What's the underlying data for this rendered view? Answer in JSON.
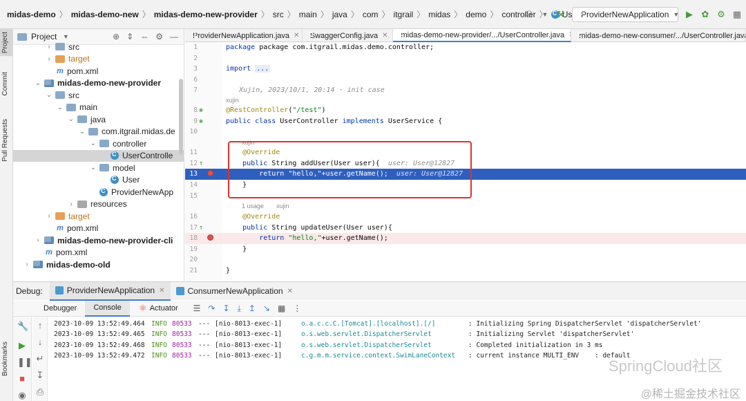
{
  "breadcrumb": {
    "items": [
      "midas-demo",
      "midas-demo-new",
      "midas-demo-new-provider",
      "src",
      "main",
      "java",
      "com",
      "itgrail",
      "midas",
      "demo",
      "controller",
      "UserController"
    ]
  },
  "toolbar": {
    "run_config": "ProviderNewApplication"
  },
  "left_stripe": {
    "project": "Project",
    "commit": "Commit",
    "pull_requests": "Pull Requests",
    "bookmarks": "Bookmarks"
  },
  "project_panel": {
    "title": "Project",
    "tree": [
      {
        "label": "src",
        "type": "folder"
      },
      {
        "label": "target",
        "type": "folder-excluded"
      },
      {
        "label": "pom.xml",
        "type": "maven"
      },
      {
        "label": "midas-demo-new-provider",
        "type": "module"
      },
      {
        "label": "src",
        "type": "folder"
      },
      {
        "label": "main",
        "type": "folder"
      },
      {
        "label": "java",
        "type": "folder"
      },
      {
        "label": "com.itgrail.midas.de",
        "type": "package"
      },
      {
        "label": "controller",
        "type": "package"
      },
      {
        "label": "UserControlle",
        "type": "class"
      },
      {
        "label": "model",
        "type": "package"
      },
      {
        "label": "User",
        "type": "class"
      },
      {
        "label": "ProviderNewApp",
        "type": "class"
      },
      {
        "label": "resources",
        "type": "folder"
      },
      {
        "label": "target",
        "type": "folder-excluded"
      },
      {
        "label": "pom.xml",
        "type": "maven"
      },
      {
        "label": "midas-demo-new-provider-cli",
        "type": "module"
      },
      {
        "label": "pom.xml",
        "type": "maven"
      },
      {
        "label": "midas-demo-old",
        "type": "module"
      }
    ]
  },
  "editor_tabs": [
    {
      "label": "ProviderNewApplication.java"
    },
    {
      "label": "SwaggerConfig.java"
    },
    {
      "label": "midas-demo-new-provider/.../UserController.java"
    },
    {
      "label": "midas-demo-new-consumer/.../UserController.java"
    }
  ],
  "code": {
    "line1": "package com.itgrail.midas.demo.controller;",
    "line3_kw": "import",
    "line3_fold": "...",
    "git_blame": "Xujin, 2023/10/1, 20:14 · init case",
    "author1": "xujin",
    "line8_ann": "@RestController",
    "line8_str": "\"/test\"",
    "line9_a": "public class",
    "line9_b": "UserController",
    "line9_c": "implements",
    "line9_d": "UserService {",
    "author2": "xujin",
    "line11": "@Override",
    "line12_kw": "public",
    "line12_rest": "String addUser(User user){",
    "line12_inlay": "user: User@12827",
    "line13_kw": "return",
    "line13_str": "\"hello,\"",
    "line13_rest": "+user.getName();",
    "line13_inlay": "user: User@12827",
    "line14": "}",
    "usage": "1 usage",
    "author3": "xujin",
    "line16": "@Override",
    "line17_kw": "public",
    "line17_rest": "String updateUser(User user){",
    "line18_kw": "return",
    "line18_str": "\"hello,\"",
    "line18_rest": "+user.getName();",
    "line19": "}",
    "line21": "}"
  },
  "debug": {
    "label": "Debug:",
    "sessions": [
      "ProviderNewApplication",
      "ConsumerNewApplication"
    ],
    "subtabs": [
      "Debugger",
      "Console",
      "Actuator"
    ],
    "log": [
      {
        "ts": "2023-10-09 13:52:49.464",
        "level": "INFO",
        "pid": "80533",
        "sep": "---",
        "thread": "[nio-8013-exec-1]",
        "logger": "o.a.c.c.C.[Tomcat].[localhost].[/]",
        "msg": ": Initializing Spring DispatcherServlet 'dispatcherServlet'"
      },
      {
        "ts": "2023-10-09 13:52:49.465",
        "level": "INFO",
        "pid": "80533",
        "sep": "---",
        "thread": "[nio-8013-exec-1]",
        "logger": "o.s.web.servlet.DispatcherServlet",
        "msg": ": Initializing Servlet 'dispatcherServlet'"
      },
      {
        "ts": "2023-10-09 13:52:49.468",
        "level": "INFO",
        "pid": "80533",
        "sep": "---",
        "thread": "[nio-8013-exec-1]",
        "logger": "o.s.web.servlet.DispatcherServlet",
        "msg": ": Completed initialization in 3 ms"
      },
      {
        "ts": "2023-10-09 13:52:49.472",
        "level": "INFO",
        "pid": "80533",
        "sep": "---",
        "thread": "[nio-8013-exec-1]",
        "logger": "c.g.m.m.service.context.SwimLaneContext",
        "msg": ": current instance MULTI_ENV    : default"
      }
    ]
  },
  "watermark": {
    "main": "SpringCloud社区",
    "sub": "@稀土掘金技术社区"
  }
}
